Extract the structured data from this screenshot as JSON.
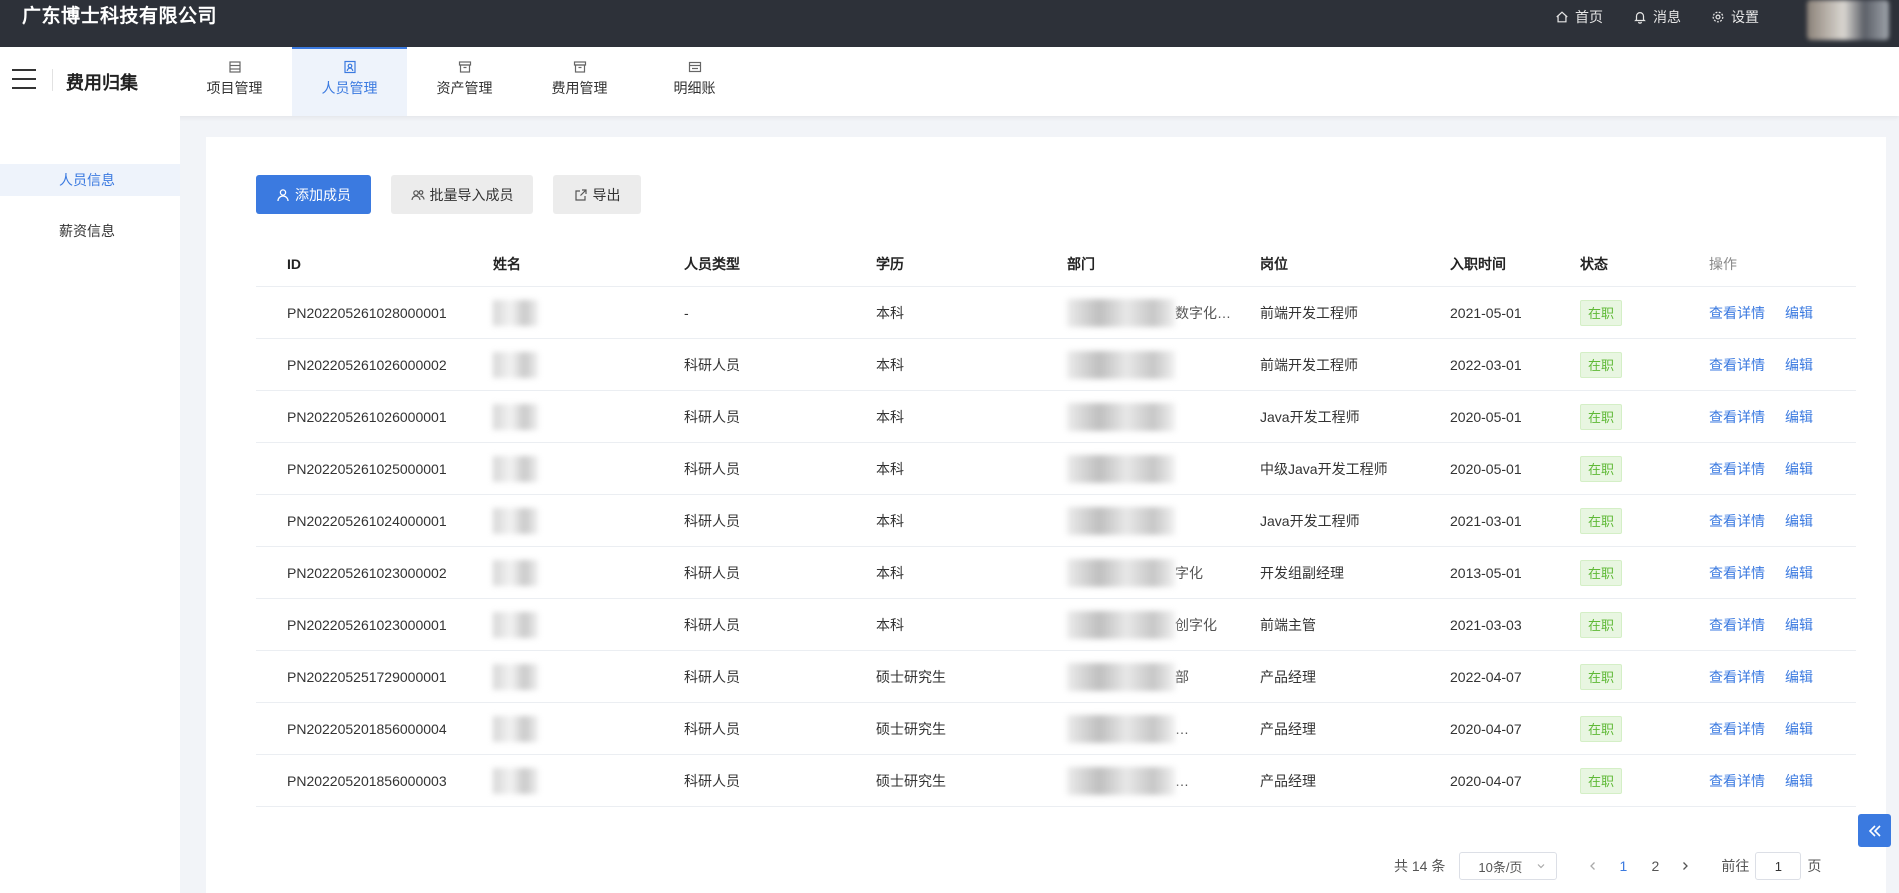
{
  "topbar": {
    "company": "广东博士科技有限公司",
    "nav": [
      {
        "label": "首页",
        "icon": "home-icon"
      },
      {
        "label": "消息",
        "icon": "bell-icon"
      },
      {
        "label": "设置",
        "icon": "gear-icon"
      }
    ]
  },
  "header": {
    "title": "费用归集",
    "tabs": [
      {
        "label": "项目管理",
        "icon": "list-icon",
        "active": false
      },
      {
        "label": "人员管理",
        "icon": "person-card-icon",
        "active": true
      },
      {
        "label": "资产管理",
        "icon": "archive-icon",
        "active": false
      },
      {
        "label": "费用管理",
        "icon": "archive-icon",
        "active": false
      },
      {
        "label": "明细账",
        "icon": "ledger-icon",
        "active": false
      }
    ]
  },
  "sidebar": {
    "items": [
      {
        "label": "人员信息",
        "active": true
      },
      {
        "label": "薪资信息",
        "active": false
      }
    ]
  },
  "toolbar": {
    "add_label": "添加成员",
    "import_label": "批量导入成员",
    "export_label": "导出"
  },
  "table": {
    "headers": {
      "id": "ID",
      "name": "姓名",
      "type": "人员类型",
      "edu": "学历",
      "dept": "部门",
      "pos": "岗位",
      "date": "入职时间",
      "status": "状态",
      "op": "操作"
    },
    "rows": [
      {
        "id": "PN202205261028000001",
        "name": "",
        "type": "-",
        "edu": "本科",
        "dept": "数字化…",
        "pos": "前端开发工程师",
        "date": "2021-05-01",
        "status": "在职"
      },
      {
        "id": "PN202205261026000002",
        "name": "",
        "type": "科研人员",
        "edu": "本科",
        "dept": "",
        "pos": "前端开发工程师",
        "date": "2022-03-01",
        "status": "在职"
      },
      {
        "id": "PN202205261026000001",
        "name": "",
        "type": "科研人员",
        "edu": "本科",
        "dept": "",
        "pos": "Java开发工程师",
        "date": "2020-05-01",
        "status": "在职"
      },
      {
        "id": "PN202205261025000001",
        "name": "",
        "type": "科研人员",
        "edu": "本科",
        "dept": "",
        "pos": "中级Java开发工程师",
        "date": "2020-05-01",
        "status": "在职"
      },
      {
        "id": "PN202205261024000001",
        "name": "",
        "type": "科研人员",
        "edu": "本科",
        "dept": "",
        "pos": "Java开发工程师",
        "date": "2021-03-01",
        "status": "在职"
      },
      {
        "id": "PN202205261023000002",
        "name": "",
        "type": "科研人员",
        "edu": "本科",
        "dept": "字化",
        "pos": "开发组副经理",
        "date": "2013-05-01",
        "status": "在职"
      },
      {
        "id": "PN202205261023000001",
        "name": "",
        "type": "科研人员",
        "edu": "本科",
        "dept": "创字化",
        "pos": "前端主管",
        "date": "2021-03-03",
        "status": "在职"
      },
      {
        "id": "PN202205251729000001",
        "name": "",
        "type": "科研人员",
        "edu": "硕士研究生",
        "dept": "部",
        "pos": "产品经理",
        "date": "2022-04-07",
        "status": "在职"
      },
      {
        "id": "PN202205201856000004",
        "name": "",
        "type": "科研人员",
        "edu": "硕士研究生",
        "dept": "…",
        "pos": "产品经理",
        "date": "2020-04-07",
        "status": "在职"
      },
      {
        "id": "PN202205201856000003",
        "name": "",
        "type": "科研人员",
        "edu": "硕士研究生",
        "dept": "…",
        "pos": "产品经理",
        "date": "2020-04-07",
        "status": "在职"
      }
    ],
    "actions": {
      "view": "查看详情",
      "edit": "编辑"
    }
  },
  "pagination": {
    "total": "共 14 条",
    "page_size": "10条/页",
    "pages": [
      "1",
      "2"
    ],
    "current": "1",
    "goto_prefix": "前往",
    "goto_value": "1",
    "goto_suffix": "页"
  },
  "colors": {
    "primary": "#3b7ae0",
    "topbar": "#2d3139",
    "success": "#5fb936"
  }
}
